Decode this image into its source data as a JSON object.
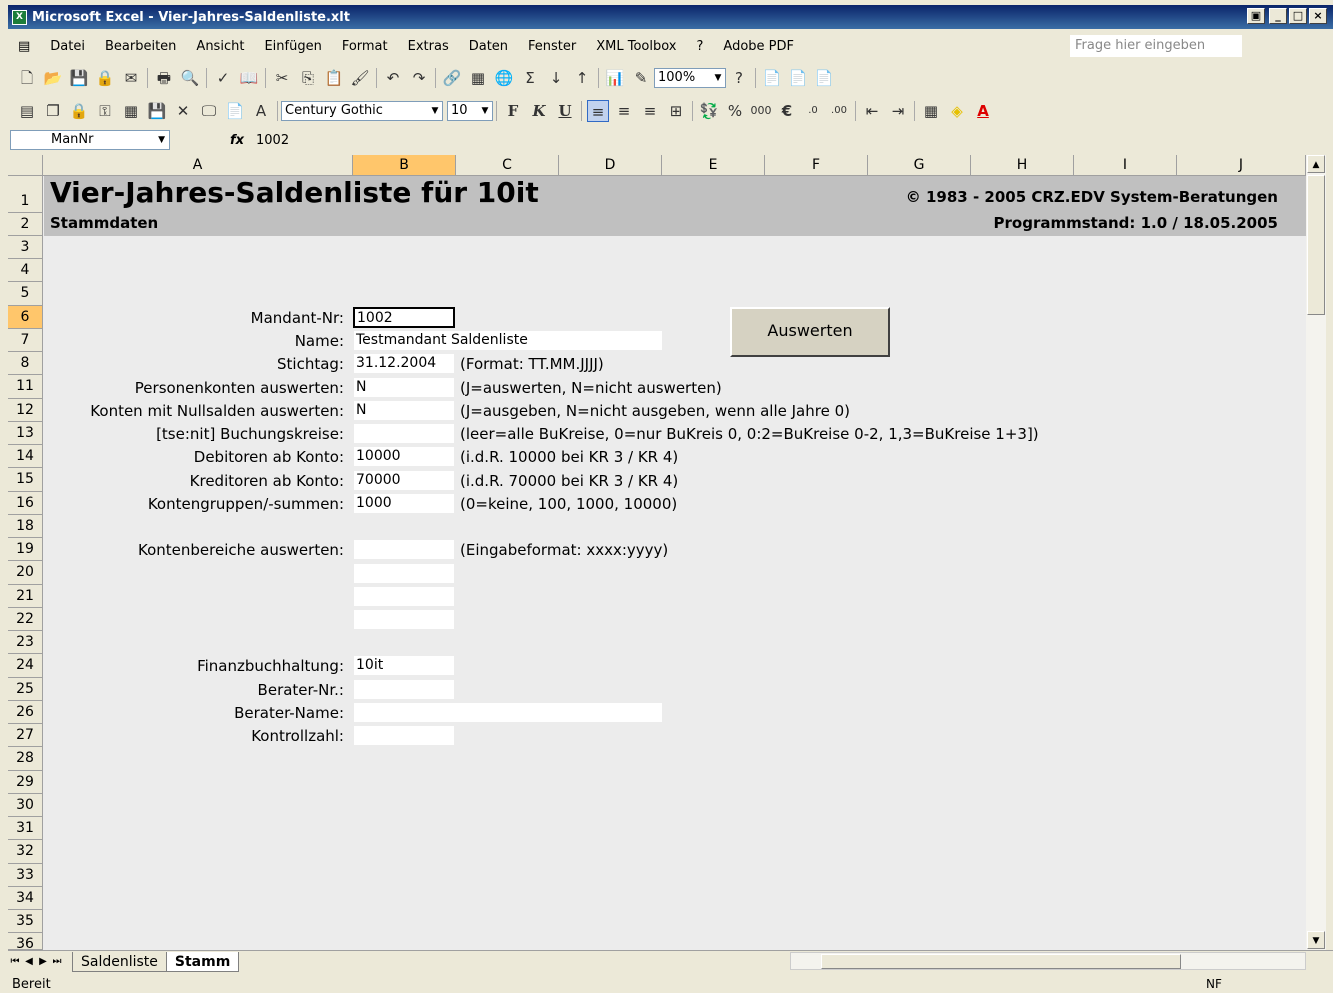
{
  "window": {
    "title": "Microsoft Excel - Vier-Jahres-Saldenliste.xlt"
  },
  "menu": {
    "items": [
      "Datei",
      "Bearbeiten",
      "Ansicht",
      "Einfügen",
      "Format",
      "Extras",
      "Daten",
      "Fenster",
      "XML Toolbox",
      "?",
      "Adobe PDF"
    ],
    "help_placeholder": "Frage hier eingeben"
  },
  "toolbar": {
    "zoom": "100%",
    "font": "Century Gothic",
    "size": "10",
    "bold": "F",
    "italic": "K",
    "underline": "U"
  },
  "formula": {
    "name_box": "ManNr",
    "fx": "fx",
    "value": "1002"
  },
  "columns": [
    "A",
    "B",
    "C",
    "D",
    "E",
    "F",
    "G",
    "H",
    "I",
    "J"
  ],
  "rows": [
    "1",
    "2",
    "3",
    "4",
    "5",
    "6",
    "7",
    "8",
    "11",
    "12",
    "13",
    "14",
    "15",
    "16",
    "18",
    "19",
    "20",
    "21",
    "22",
    "23",
    "24",
    "25",
    "26",
    "27",
    "28",
    "29",
    "30",
    "31",
    "32",
    "33",
    "34",
    "35",
    "36"
  ],
  "banner": {
    "title": "Vier-Jahres-Saldenliste für 10it",
    "subtitle": "Stammdaten",
    "copyright": "© 1983 - 2005 CRZ.EDV System-Beratungen",
    "program": "Programmstand: 1.0 / 18.05.2005"
  },
  "form": {
    "mandant_label": "Mandant-Nr:",
    "mandant_value": "1002",
    "name_label": "Name:",
    "name_value": "Testmandant Saldenliste",
    "stichtag_label": "Stichtag:",
    "stichtag_value": "31.12.2004",
    "stichtag_hint": "(Format: TT.MM.JJJJ)",
    "personen_label": "Personenkonten auswerten:",
    "personen_value": "N",
    "personen_hint": "(J=auswerten, N=nicht auswerten)",
    "null_label": "Konten mit Nullsalden auswerten:",
    "null_value": "N",
    "null_hint": "(J=ausgeben, N=nicht ausgeben, wenn alle Jahre 0)",
    "bukreise_label": "[tse:nit] Buchungskreise:",
    "bukreise_value": "",
    "bukreise_hint": "(leer=alle BuKreise, 0=nur BuKreis 0, 0:2=BuKreise 0-2, 1,3=BuKreise 1+3])",
    "debitoren_label": "Debitoren ab Konto:",
    "debitoren_value": "10000",
    "debitoren_hint": "(i.d.R. 10000 bei KR 3 / KR 4)",
    "kreditoren_label": "Kreditoren ab Konto:",
    "kreditoren_value": "70000",
    "kreditoren_hint": "(i.d.R. 70000 bei KR 3 / KR 4)",
    "gruppen_label": "Kontengruppen/-summen:",
    "gruppen_value": "1000",
    "gruppen_hint": "(0=keine, 100, 1000, 10000)",
    "bereiche_label": "Kontenbereiche auswerten:",
    "bereiche_hint": "(Eingabeformat: xxxx:yyyy)",
    "fibu_label": "Finanzbuchhaltung:",
    "fibu_value": "10it",
    "beraternr_label": "Berater-Nr.:",
    "beratername_label": "Berater-Name:",
    "kontroll_label": "Kontrollzahl:",
    "button": "Auswerten"
  },
  "sheets": [
    "Saldenliste",
    "Stamm"
  ],
  "status": {
    "left": "Bereit",
    "right": "NF"
  }
}
